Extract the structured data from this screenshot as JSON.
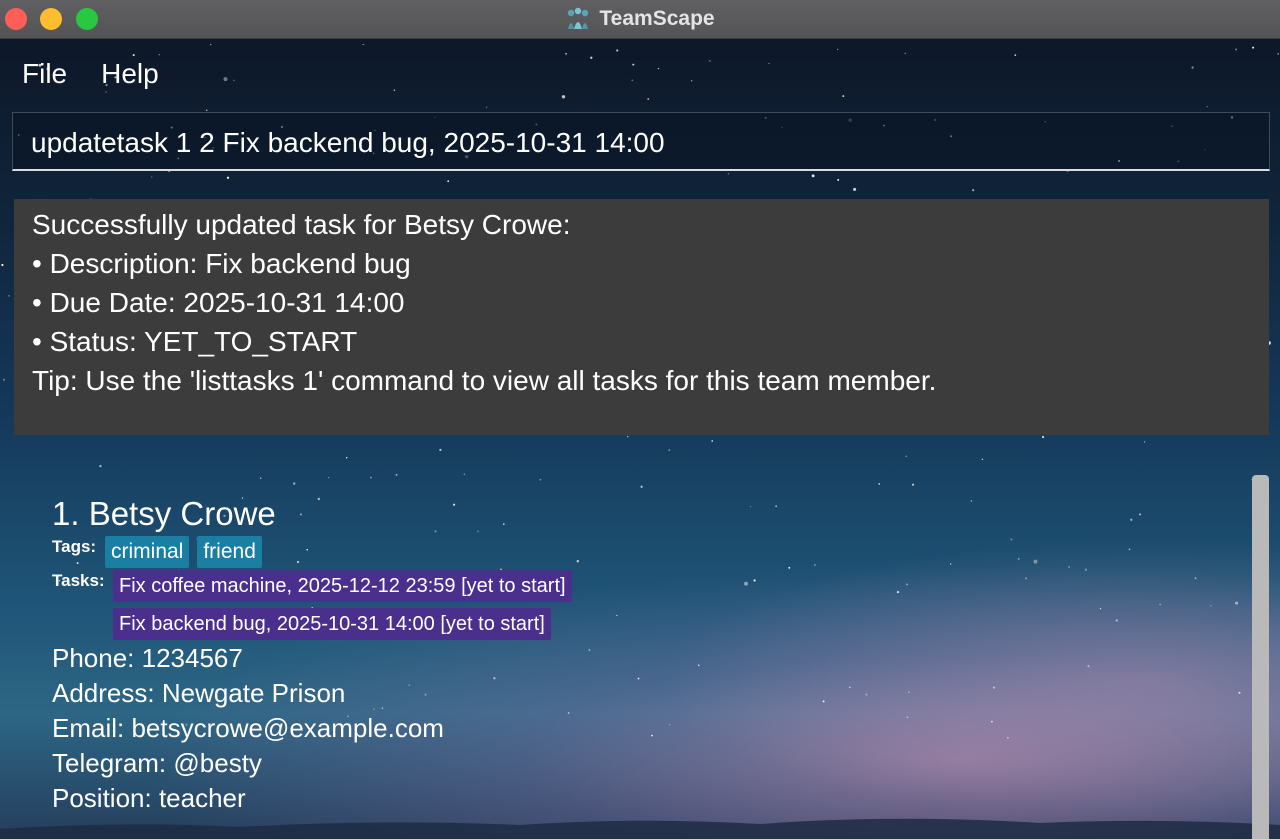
{
  "window": {
    "title": "TeamScape",
    "logo_icon": "teamscape-logo-icon"
  },
  "menu": {
    "file": "File",
    "help": "Help"
  },
  "command": {
    "value": "updatetask 1 2 Fix backend bug, 2025-10-31 14:00"
  },
  "result": {
    "lines": [
      "Successfully updated task for Betsy Crowe:",
      "• Description: Fix backend bug",
      "• Due Date: 2025-10-31 14:00",
      "• Status: YET_TO_START",
      "Tip: Use the 'listtasks 1' command to view all tasks for this team member."
    ]
  },
  "persons": [
    {
      "name": "1. Betsy Crowe",
      "tags_label": "Tags:",
      "tags": [
        "criminal",
        "friend"
      ],
      "tasks_label": "Tasks:",
      "tasks": [
        "Fix coffee machine, 2025-12-12 23:59 [yet to start]",
        "Fix backend bug, 2025-10-31 14:00 [yet to start]"
      ],
      "phone": "Phone: 1234567",
      "address": "Address: Newgate Prison",
      "email": "Email: betsycrowe@example.com",
      "telegram": "Telegram: @besty",
      "position": "Position: teacher"
    }
  ],
  "colors": {
    "tag_bg": "#1a7fa3",
    "task_bg": "#4b2f8c",
    "result_bg": "#3c3c3c",
    "close": "#ff5f57",
    "minimize": "#febc2e",
    "maximize": "#28c840"
  }
}
